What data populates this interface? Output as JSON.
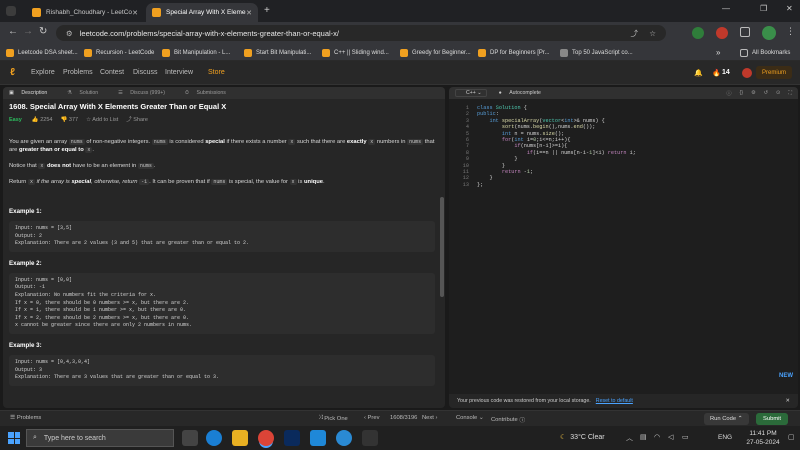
{
  "browser": {
    "tabs": [
      {
        "title": "Rishabh_Choudhary - LeetCode"
      },
      {
        "title": "Special Array With X Elements G"
      }
    ],
    "url": "leetcode.com/problems/special-array-with-x-elements-greater-than-or-equal-x/",
    "bookmarks": [
      "Leetcode DSA sheet...",
      "Recursion - LeetCode",
      "Bit Manipulation - L...",
      "Start Bit Manipulati...",
      "C++ || Sliding wind...",
      "Greedy for Beginner...",
      "DP for Beginners [Pr...",
      "Top 50 JavaScript co..."
    ],
    "all_bookmarks": "All Bookmarks"
  },
  "leetcode": {
    "nav": [
      "Explore",
      "Problems",
      "Contest",
      "Discuss",
      "Interview",
      "Store"
    ],
    "streak": "14",
    "premium": "Premium",
    "left_tabs": [
      "Description",
      "Solution",
      "Discuss (999+)",
      "Submissions"
    ],
    "problem": {
      "title": "1608. Special Array With X Elements Greater Than or Equal X",
      "difficulty": "Easy",
      "likes": "2254",
      "dislikes": "377",
      "add_to_list": "Add to List",
      "share": "Share",
      "p1a": "You are given an array ",
      "p1b": "nums",
      "p1c": " of non-negative integers. ",
      "p1d": "nums",
      "p1e": " is considered ",
      "p1f": "special",
      "p1g": " if there exists a number ",
      "p1h": "x",
      "p1i": " such that there are ",
      "p1j": "exactly",
      "p1k": "x",
      "p1l": " numbers in ",
      "p1m": "nums",
      "p1n": " that are ",
      "p1o": "greater than or equal to",
      "p1p": "x",
      "p2a": "Notice that ",
      "p2b": "x",
      "p2c": " does not",
      "p2d": " have to be an element in ",
      "p2e": "nums",
      "p3a": "Return ",
      "p3b": "x",
      "p3c": " if the array is ",
      "p3d": "special",
      "p3e": ", otherwise, return ",
      "p3f": "-1",
      "p3g": ". It can be proven that if ",
      "p3h": "nums",
      "p3i": " is special, the value for ",
      "p3j": "x",
      "p3k": " is ",
      "p3l": "unique",
      "examples": [
        {
          "title": "Example 1:",
          "body": "Input: nums = [3,5]\nOutput: 2\nExplanation: There are 2 values (3 and 5) that are greater than or equal to 2."
        },
        {
          "title": "Example 2:",
          "body": "Input: nums = [0,0]\nOutput: -1\nExplanation: No numbers fit the criteria for x.\nIf x = 0, there should be 0 numbers >= x, but there are 2.\nIf x = 1, there should be 1 number >= x, but there are 0.\nIf x = 2, there should be 2 numbers >= x, but there are 0.\nx cannot be greater since there are only 2 numbers in nums."
        },
        {
          "title": "Example 3:",
          "body": "Input: nums = [0,4,3,0,4]\nOutput: 3\nExplanation: There are 3 values that are greater than or equal to 3."
        }
      ]
    },
    "editor": {
      "language": "C++",
      "autocomplete": "Autocomplete",
      "new_badge": "NEW",
      "restore_msg": "Your previous code was restored from your local storage.",
      "reset": "Reset to default"
    },
    "bottom": {
      "problems": "Problems",
      "pick_one": "Pick One",
      "prev": "Prev",
      "counter": "1608/3196",
      "next": "Next",
      "console": "Console",
      "contribute": "Contribute",
      "run": "Run Code",
      "submit": "Submit"
    }
  },
  "taskbar": {
    "search": "Type here to search",
    "weather": "33°C  Clear",
    "lang": "ENG",
    "time": "11:41 PM",
    "date": "27-05-2024"
  }
}
